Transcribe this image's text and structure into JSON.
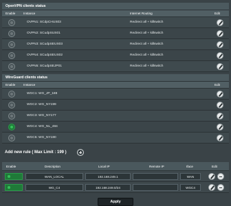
{
  "openvpn": {
    "title": "OpenVPN clients status",
    "headers": {
      "enable": "Enable",
      "instance": "Instance",
      "routing": "Internet Routing",
      "edit": "Edit"
    },
    "rows": [
      {
        "instance": "OVPN1: SCdpCHUS03",
        "routing": "Redirect all + killswitch",
        "enabled": false
      },
      {
        "instance": "OVPN2: SCudpSUS01",
        "routing": "Redirect all + killswitch",
        "enabled": false
      },
      {
        "instance": "OVPN3: SCudpSEUS03",
        "routing": "Redirect all + killswitch",
        "enabled": false
      },
      {
        "instance": "OVPN4: SCudpSEUS02",
        "routing": "Redirect all + killswitch",
        "enabled": false
      },
      {
        "instance": "OVPN5: SCudpSEJP01",
        "routing": "Redirect all + killswitch",
        "enabled": false
      }
    ]
  },
  "wireguard": {
    "title": "WireGuard clients status",
    "headers": {
      "enable": "Enable",
      "instance": "Instance",
      "edit": "Edit"
    },
    "rows": [
      {
        "instance": "WGC1: WG_JP_188",
        "enabled": false
      },
      {
        "instance": "WGC2: WG_NY199",
        "enabled": false
      },
      {
        "instance": "WGC3: WG_NY177",
        "enabled": false
      },
      {
        "instance": "WGC4: WG_NL_484",
        "enabled": true
      },
      {
        "instance": "WGC5: WG_NY180",
        "enabled": false
      }
    ]
  },
  "add_rule": {
    "label": "Add new rule ( Max Limit : 199 )"
  },
  "rules": {
    "headers": {
      "enable": "Enable",
      "description": "Description",
      "local_ip": "Local IP",
      "remote_ip": "Remote IP",
      "iface": "Iface",
      "edit": "Edit"
    },
    "rows": [
      {
        "description": "WAN_LOCAL",
        "local_ip": "192.168.249.1",
        "remote_ip": "",
        "iface": "WAN"
      },
      {
        "description": "WG_C4",
        "local_ip": "192.168.249.0/24",
        "remote_ip": "",
        "iface": "WGC4"
      }
    ]
  },
  "apply_label": "Apply",
  "colors": {
    "enabled_green": "#36c05a",
    "background": "#3a4347",
    "title_bar": "#4c5a5f"
  }
}
